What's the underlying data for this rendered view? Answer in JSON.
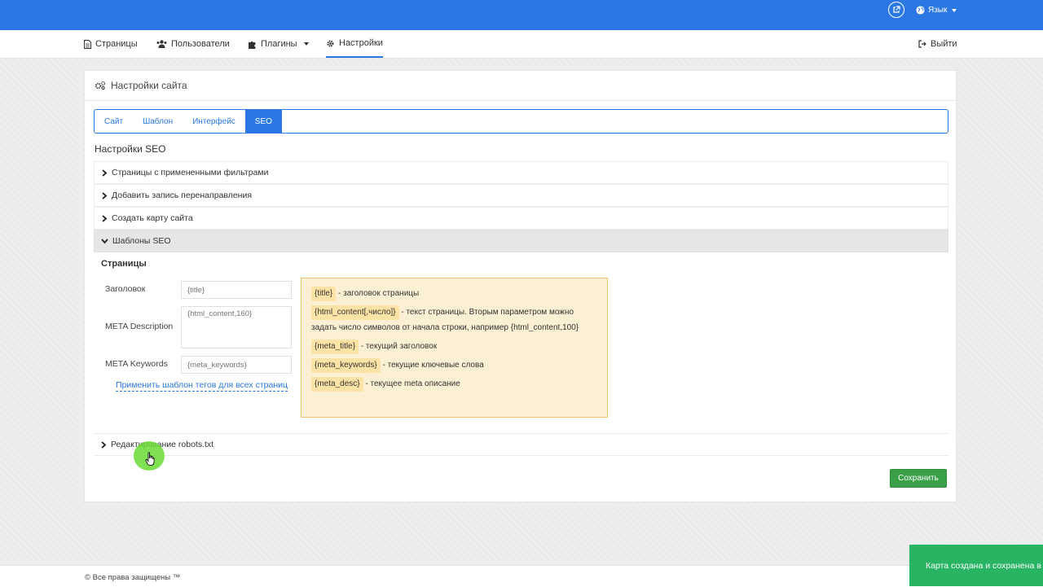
{
  "topbar": {
    "language_label": "Язык"
  },
  "nav": {
    "pages": "Страницы",
    "users": "Пользователи",
    "plugins": "Плагины",
    "settings": "Настройки",
    "logout": "Выйти"
  },
  "panel": {
    "title": "Настройки сайта"
  },
  "tabs": [
    "Сайт",
    "Шаблон",
    "Интерфейс",
    "SEO"
  ],
  "seo_section_title": "Настройки SEO",
  "accordion": [
    "Страницы с примененными фильтрами",
    "Добавить запись перенаправления",
    "Создать карту сайта",
    "Шаблоны SEO",
    "Редактирование robots.txt"
  ],
  "seo_templates": {
    "pages_heading": "Страницы",
    "title_label": "Заголовок",
    "title_placeholder": "{title}",
    "desc_label": "META Description",
    "desc_placeholder": "{html_content,160}",
    "keywords_label": "META Keywords",
    "keywords_placeholder": "{meta_keywords}",
    "apply_link": "Применить шаблон тегов для всех страниц"
  },
  "help": [
    {
      "tag": "{title}",
      "text": " - заголовок страницы"
    },
    {
      "tag": "{html_content[,число]}",
      "text": " - текст страницы. Вторым параметром можно задать число символов от начала строки, например {html_content,100}"
    },
    {
      "tag": "{meta_title}",
      "text": " - текущий заголовок"
    },
    {
      "tag": "{meta_keywords}",
      "text": " - текущие ключевые слова"
    },
    {
      "tag": "{meta_desc}",
      "text": " - текущее meta описание"
    }
  ],
  "save_button": "Сохранить",
  "footer": "© Все права защищены ™",
  "toast": "Карта создана и сохранена в",
  "colors": {
    "primary": "#2b78e4",
    "success": "#3aa047",
    "toast": "#28b463",
    "help_bg": "#fcf0d4"
  }
}
